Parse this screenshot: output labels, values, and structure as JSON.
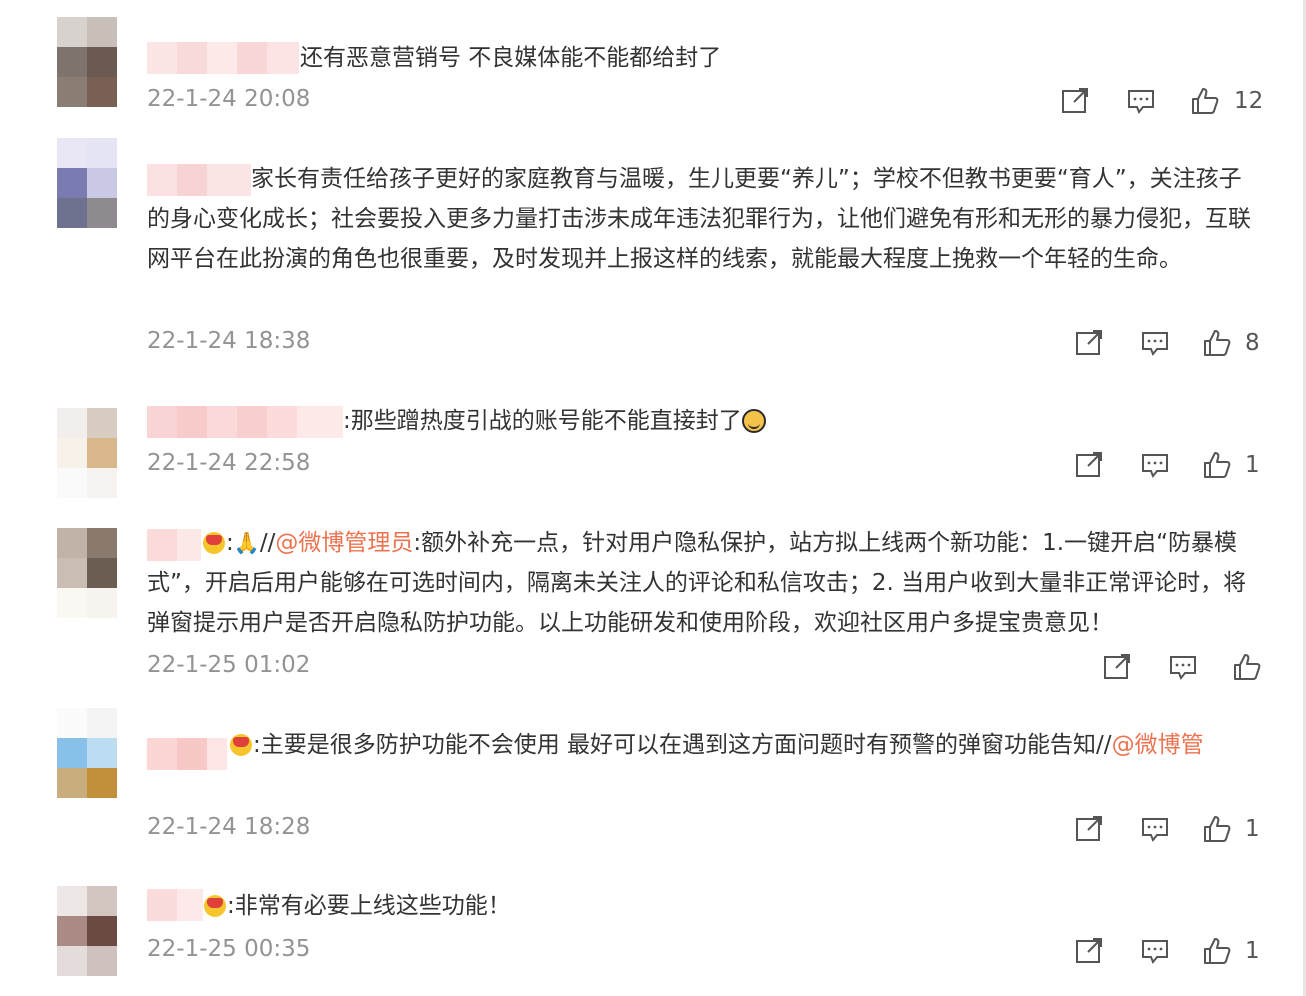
{
  "icons": {
    "share": "share-icon",
    "comment": "comment-icon",
    "like": "thumbs-up-icon"
  },
  "colors": {
    "mention": "#eb7350",
    "timestamp": "#939393",
    "text": "#333333"
  },
  "comments": [
    {
      "text_parts": [
        "还有恶意营销号 不良媒体能不能都给封了"
      ],
      "time": "22-1-24 20:08",
      "likes": "12"
    },
    {
      "text_parts": [
        "家长有责任给孩子更好的家庭教育与温暖，生儿更要“养儿”；学校不但教书更要“育人”，关注孩子的身心变化成长；社会要投入更多力量打击涉未成年违法犯罪行为，让他们避免有形和无形的暴力侵犯，互联网平台在此扮演的角色也很重要，及时发现并上报这样的线索，就能最大程度上挽救一个年轻的生命。"
      ],
      "time": "22-1-24 18:38",
      "likes": "8"
    },
    {
      "text_parts": [
        ":那些蹭热度引战的账号能不能直接封了"
      ],
      "time": "22-1-24 22:58",
      "likes": "1"
    },
    {
      "text_parts": [
        ":",
        "//",
        "@微博管理员",
        ":额外补充一点，针对用户隐私保护，站方拟上线两个新功能：1.一键开启“防暴模式”，开启后用户能够在可选时间内，隔离未关注人的评论和私信攻击；2. 当用户收到大量非正常评论时，将弹窗提示用户是否开启隐私防护功能。以上功能研发和使用阶段，欢迎社区用户多提宝贵意见！"
      ],
      "time": "22-1-25 01:02",
      "likes": ""
    },
    {
      "text_parts": [
        ":主要是很多防护功能不会使用 最好可以在遇到这方面问题时有预警的弹窗功能告知//",
        "@微博管"
      ],
      "time": "22-1-24 18:28",
      "likes": "1"
    },
    {
      "text_parts": [
        ":非常有必要上线这些功能！"
      ],
      "time": "22-1-25 00:35",
      "likes": "1"
    }
  ]
}
